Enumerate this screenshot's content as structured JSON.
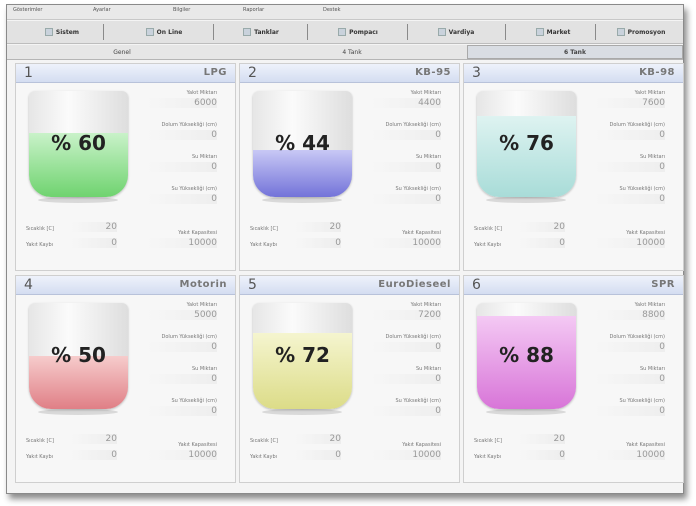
{
  "menu": [
    "Gösterimler",
    "Ayarlar",
    "Bilgiler",
    "Raporlar",
    "Destek"
  ],
  "toolbar": [
    "Sistem",
    "On Line",
    "Tanklar",
    "Pompacı",
    "Vardiya",
    "Market",
    "Promosyon"
  ],
  "tabs": [
    "Genel",
    "4 Tank",
    "6 Tank"
  ],
  "labels": {
    "product_amount": "Yakıt Miktarı",
    "fuel_height": "Dolum Yüksekliği (cm)",
    "water_amount": "Su Miktarı",
    "water_height": "Su Yüksekliği (cm)",
    "temperature": "Sıcaklık [C]",
    "fuel_loss": "Yakıt Kaybı",
    "capacity": "Yakıt Kapasitesi"
  },
  "tanks": [
    {
      "num": "1",
      "name": "LPG",
      "pct_label": "% 60",
      "pct": 60,
      "color_top": "#c9f2c9",
      "color_bottom": "#6fd36f",
      "product_amount": "6000",
      "fuel_height": "0",
      "water_amount": "0",
      "water_height": "0",
      "temperature": "20",
      "fuel_loss": "0",
      "capacity": "10000"
    },
    {
      "num": "2",
      "name": "KB-95",
      "pct_label": "% 44",
      "pct": 44,
      "color_top": "#c8c8f5",
      "color_bottom": "#7373d9",
      "product_amount": "4400",
      "fuel_height": "0",
      "water_amount": "0",
      "water_height": "0",
      "temperature": "20",
      "fuel_loss": "0",
      "capacity": "10000"
    },
    {
      "num": "3",
      "name": "KB-98",
      "pct_label": "% 76",
      "pct": 76,
      "color_top": "#def3f1",
      "color_bottom": "#a8dcd8",
      "product_amount": "7600",
      "fuel_height": "0",
      "water_amount": "0",
      "water_height": "0",
      "temperature": "20",
      "fuel_loss": "0",
      "capacity": "10000"
    },
    {
      "num": "4",
      "name": "Motorin",
      "pct_label": "% 50",
      "pct": 50,
      "color_top": "#f6cccc",
      "color_bottom": "#e07f86",
      "product_amount": "5000",
      "fuel_height": "0",
      "water_amount": "0",
      "water_height": "0",
      "temperature": "20",
      "fuel_loss": "0",
      "capacity": "10000"
    },
    {
      "num": "5",
      "name": "EuroDieseel",
      "pct_label": "% 72",
      "pct": 72,
      "color_top": "#f5f5cf",
      "color_bottom": "#dcdc88",
      "product_amount": "7200",
      "fuel_height": "0",
      "water_amount": "0",
      "water_height": "0",
      "temperature": "20",
      "fuel_loss": "0",
      "capacity": "10000"
    },
    {
      "num": "6",
      "name": "SPR",
      "pct_label": "% 88",
      "pct": 88,
      "color_top": "#f4c9f4",
      "color_bottom": "#d875d8",
      "product_amount": "8800",
      "fuel_height": "0",
      "water_amount": "0",
      "water_height": "0",
      "temperature": "20",
      "fuel_loss": "0",
      "capacity": "10000"
    }
  ]
}
